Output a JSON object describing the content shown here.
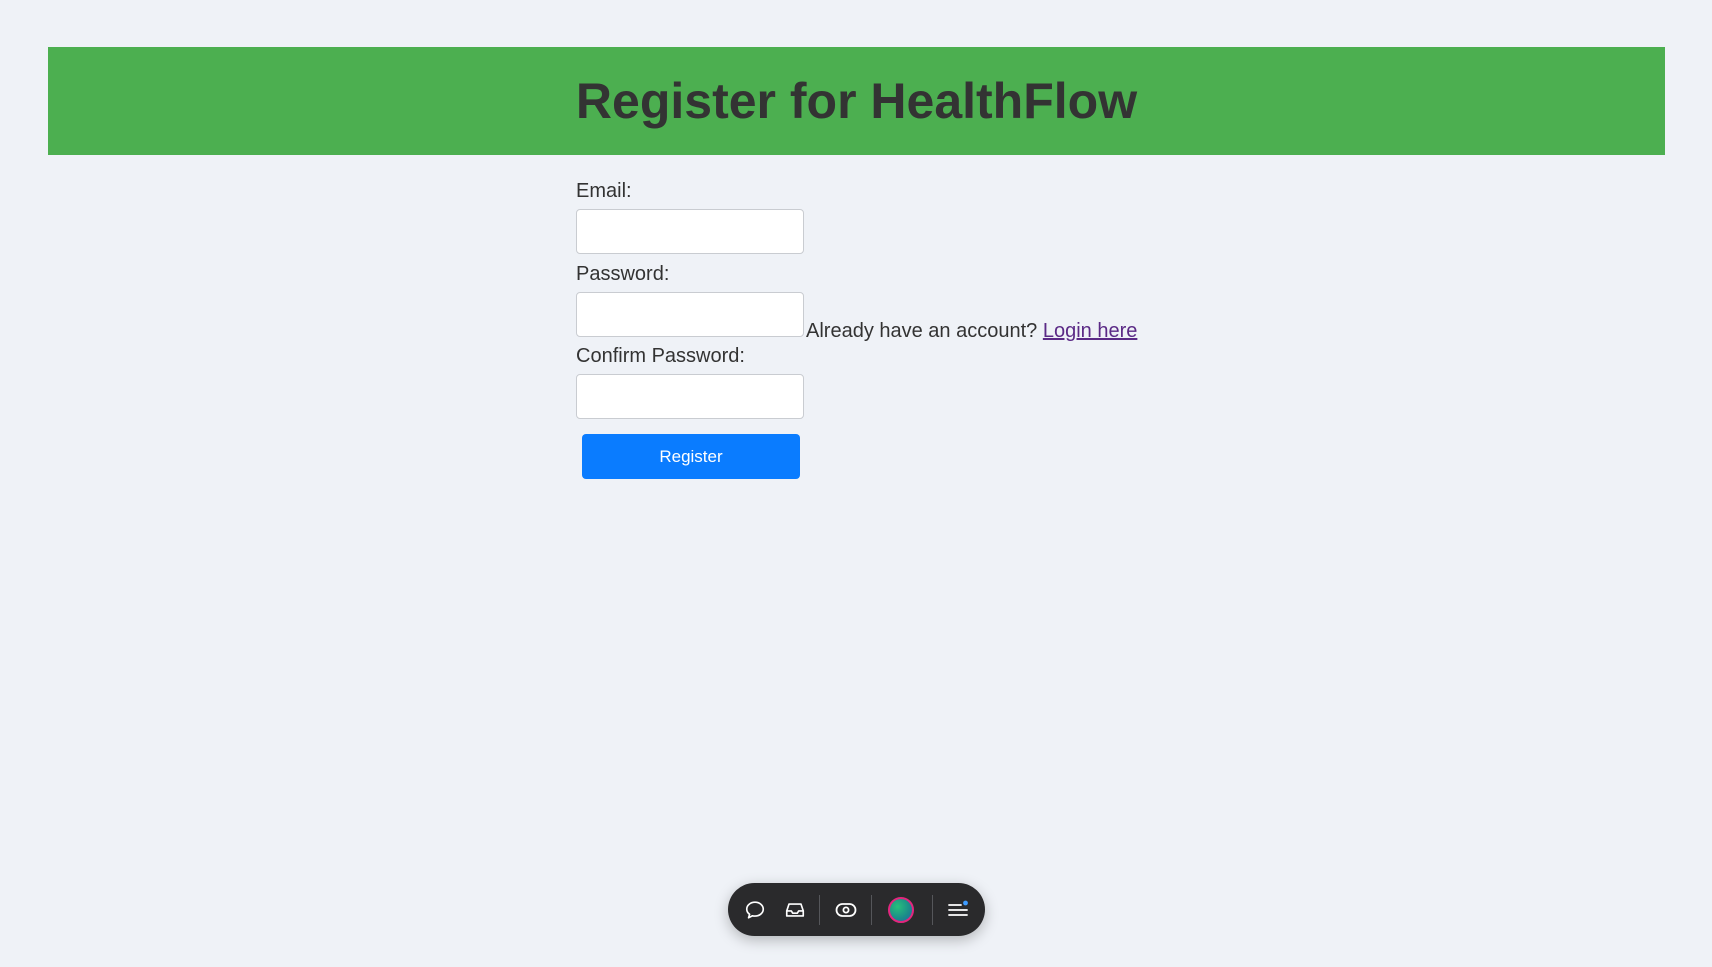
{
  "header": {
    "title": "Register for HealthFlow"
  },
  "form": {
    "email_label": "Email:",
    "email_value": "",
    "password_label": "Password:",
    "password_value": "",
    "confirm_label": "Confirm Password:",
    "confirm_value": "",
    "register_label": "Register"
  },
  "account": {
    "prompt": "Already have an account?",
    "login_link": "Login here"
  },
  "toolbar": {
    "icons": [
      "chat-icon",
      "inbox-icon",
      "eye-icon",
      "avatar",
      "menu-icon"
    ]
  },
  "colors": {
    "header_bg": "#4caf50",
    "button_bg": "#0a7cff",
    "link": "#5b2a86",
    "page_bg": "#eff2f7"
  }
}
